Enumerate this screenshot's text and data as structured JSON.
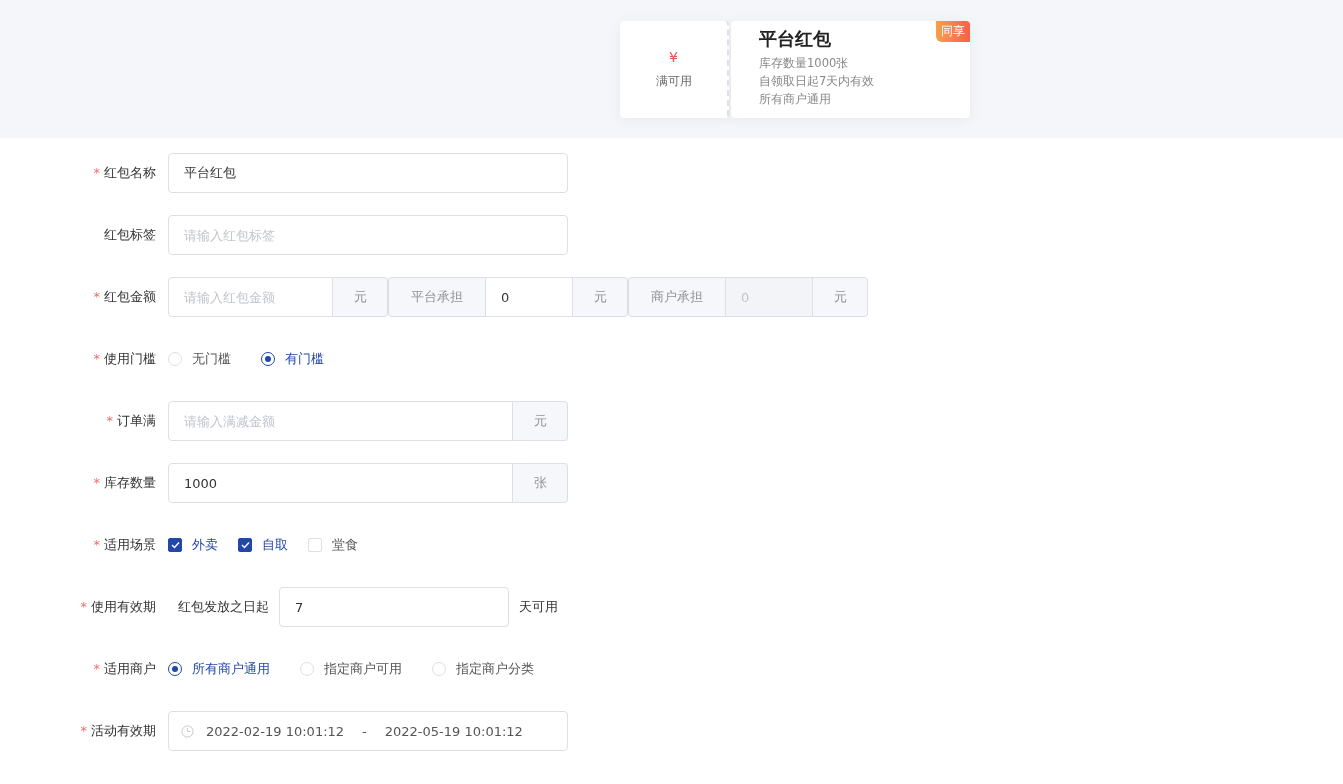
{
  "coupon_preview": {
    "symbol": "¥",
    "condition": "满可用",
    "title": "平台红包",
    "lines": [
      "库存数量1000张",
      "自领取日起7天内有效",
      "所有商户通用"
    ],
    "badge": "同享"
  },
  "form": [
    {
      "kind": "input",
      "label": "红包名称",
      "required_mark": "*",
      "value": "平台红包"
    },
    {
      "kind": "input",
      "label": "红包标签",
      "placeholder": "请输入红包标签"
    },
    {
      "kind": "amounts",
      "label": "红包金额",
      "required_mark": "*",
      "parts": [
        {
          "placeholder": "请输入红包金额",
          "suffix": "元",
          "disabled": false
        },
        {
          "prefix": "平台承担",
          "value": "0",
          "suffix": "元",
          "disabled": false
        },
        {
          "prefix": "商户承担",
          "value": "0",
          "suffix": "元",
          "disabled": true
        }
      ]
    },
    {
      "kind": "radio",
      "label": "使用门槛",
      "required_mark": "*",
      "options": [
        {
          "label": "无门槛",
          "selected": false
        },
        {
          "label": "有门槛",
          "selected": true
        }
      ]
    },
    {
      "kind": "input",
      "label": "订单满",
      "required_mark": "*",
      "placeholder": "请输入满减金额",
      "suffix": "元"
    },
    {
      "kind": "input",
      "label": "库存数量",
      "required_mark": "*",
      "value": "1000",
      "suffix": "张"
    },
    {
      "kind": "checkbox",
      "label": "适用场景",
      "required_mark": "*",
      "options": [
        {
          "label": "外卖",
          "checked": true
        },
        {
          "label": "自取",
          "checked": true
        },
        {
          "label": "堂食",
          "checked": false
        }
      ]
    },
    {
      "kind": "days",
      "label": "使用有效期",
      "required_mark": "*",
      "before": "红包发放之日起",
      "value": "7",
      "after": "天可用"
    },
    {
      "kind": "radio",
      "label": "适用商户",
      "required_mark": "*",
      "options": [
        {
          "label": "所有商户通用",
          "selected": true
        },
        {
          "label": "指定商户可用",
          "selected": false
        },
        {
          "label": "指定商户分类",
          "selected": false
        }
      ]
    },
    {
      "kind": "daterange",
      "label": "活动有效期",
      "required_mark": "*",
      "start": "2022-02-19 10:01:12",
      "separator": "-",
      "end": "2022-05-19 10:01:12"
    }
  ]
}
